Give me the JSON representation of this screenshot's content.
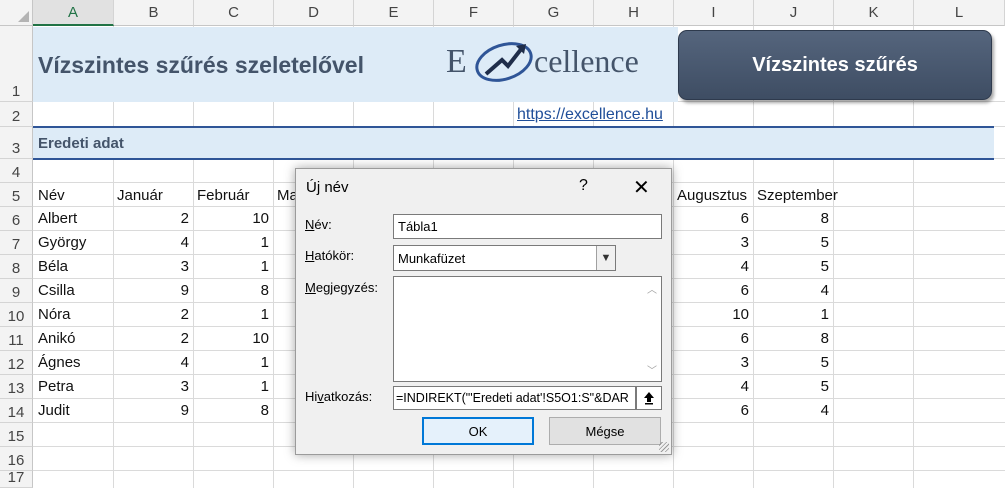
{
  "columns": [
    "A",
    "B",
    "C",
    "D",
    "E",
    "F",
    "G",
    "H",
    "I",
    "J",
    "K",
    "L"
  ],
  "rows": [
    "1",
    "2",
    "3",
    "4",
    "5",
    "6",
    "7",
    "8",
    "9",
    "10",
    "11",
    "12",
    "13",
    "14",
    "15",
    "16",
    "17"
  ],
  "title": "Vízszintes szűrés szeletelővel",
  "logo": {
    "e": "E",
    "rest": "cellence"
  },
  "button_label": "Vízszintes szűrés",
  "link": "https://excellence.hu",
  "subtitle": "Eredeti adat",
  "headers": {
    "name": "Név",
    "jan": "Január",
    "feb": "Február",
    "mar_partial": "Ma",
    "aug": "Augusztus",
    "sep": "Szeptember"
  },
  "table": [
    {
      "name": "Albert",
      "jan": "2",
      "feb": "10",
      "aug": "6",
      "sep": "8"
    },
    {
      "name": "György",
      "jan": "4",
      "feb": "1",
      "aug": "3",
      "sep": "5"
    },
    {
      "name": "Béla",
      "jan": "3",
      "feb": "1",
      "aug": "4",
      "sep": "5"
    },
    {
      "name": "Csilla",
      "jan": "9",
      "feb": "8",
      "aug": "6",
      "sep": "4"
    },
    {
      "name": "Nóra",
      "jan": "2",
      "feb": "1",
      "aug": "10",
      "sep": "1"
    },
    {
      "name": "Anikó",
      "jan": "2",
      "feb": "10",
      "aug": "6",
      "sep": "8"
    },
    {
      "name": "Ágnes",
      "jan": "4",
      "feb": "1",
      "aug": "3",
      "sep": "5"
    },
    {
      "name": "Petra",
      "jan": "3",
      "feb": "1",
      "aug": "4",
      "sep": "5"
    },
    {
      "name": "Judit",
      "jan": "9",
      "feb": "8",
      "aug": "6",
      "sep": "4"
    }
  ],
  "dialog": {
    "title": "Új név",
    "help": "?",
    "close": "✕",
    "name_label_u": "N",
    "name_label": "év:",
    "name_value": "Tábla1",
    "scope_label_u": "H",
    "scope_label": "atókör:",
    "scope_value": "Munkafüzet",
    "comment_label_u": "M",
    "comment_label": "egjegyzés:",
    "ref_label_pre": "Hi",
    "ref_label_u": "v",
    "ref_label": "atkozás:",
    "ref_value": "=INDIREKT(\"'Eredeti adat'!S5O1:S\"&DAR",
    "ok": "OK",
    "cancel": "Mégse"
  },
  "colors": {
    "band": "#ddebf7",
    "title": "#44546a",
    "button": "#44546a",
    "excel_green": "#217346"
  }
}
